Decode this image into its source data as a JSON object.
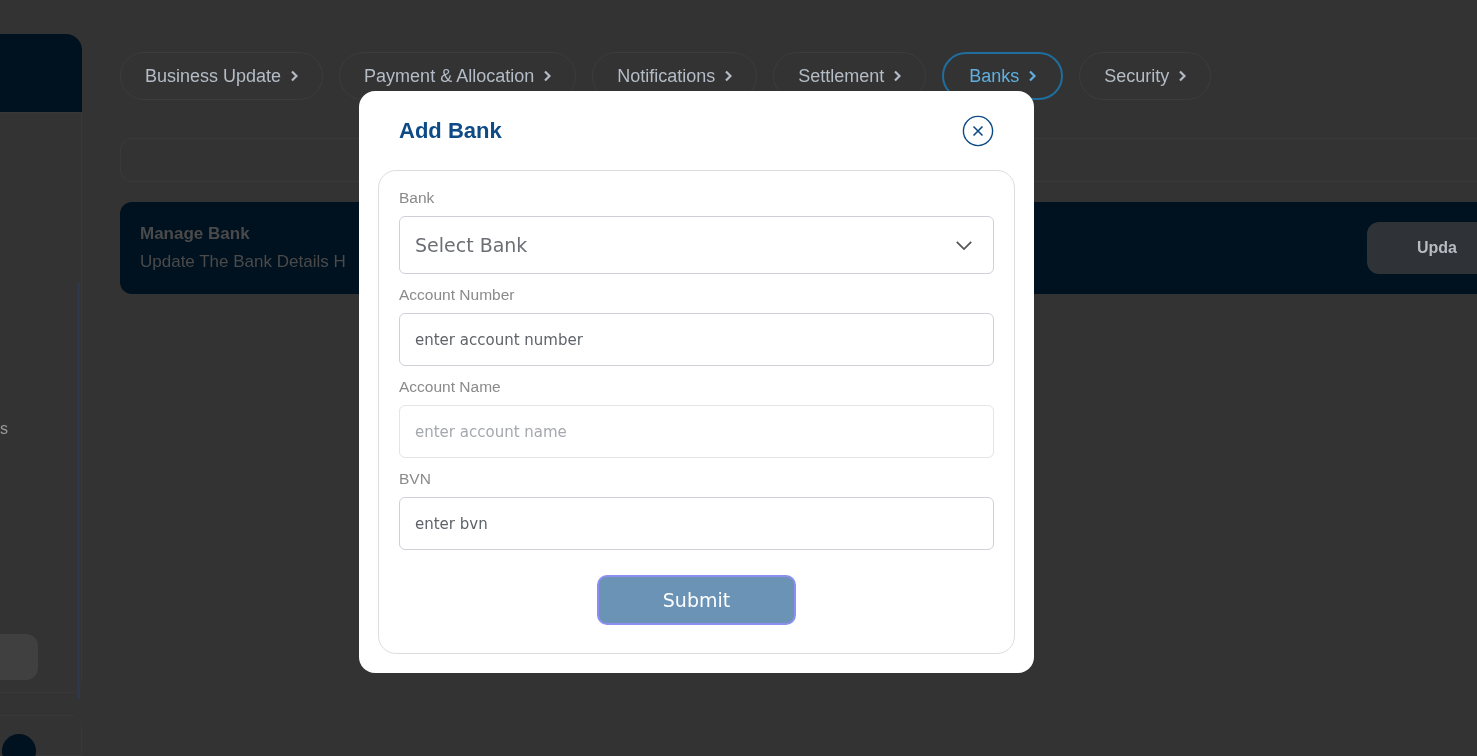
{
  "sidebar": {
    "partial_label": "s"
  },
  "tabs": [
    {
      "label": "Business Update",
      "selected": false
    },
    {
      "label": "Payment & Allocation",
      "selected": false
    },
    {
      "label": "Notifications",
      "selected": false
    },
    {
      "label": "Settlement",
      "selected": false
    },
    {
      "label": "Banks",
      "selected": true
    },
    {
      "label": "Security",
      "selected": false
    }
  ],
  "banner": {
    "title": "Manage Bank",
    "subtitle": "Update The Bank Details H",
    "button": "Upda"
  },
  "modal": {
    "title": "Add Bank",
    "fields": [
      {
        "kind": "select",
        "label": "Bank",
        "placeholder": "Select Bank",
        "disabled": false
      },
      {
        "kind": "input",
        "label": "Account Number",
        "placeholder": "enter account number",
        "disabled": false
      },
      {
        "kind": "input",
        "label": "Account Name",
        "placeholder": "enter account name",
        "disabled": true
      },
      {
        "kind": "input",
        "label": "BVN",
        "placeholder": "enter bvn",
        "disabled": false
      }
    ],
    "submit": "Submit"
  }
}
